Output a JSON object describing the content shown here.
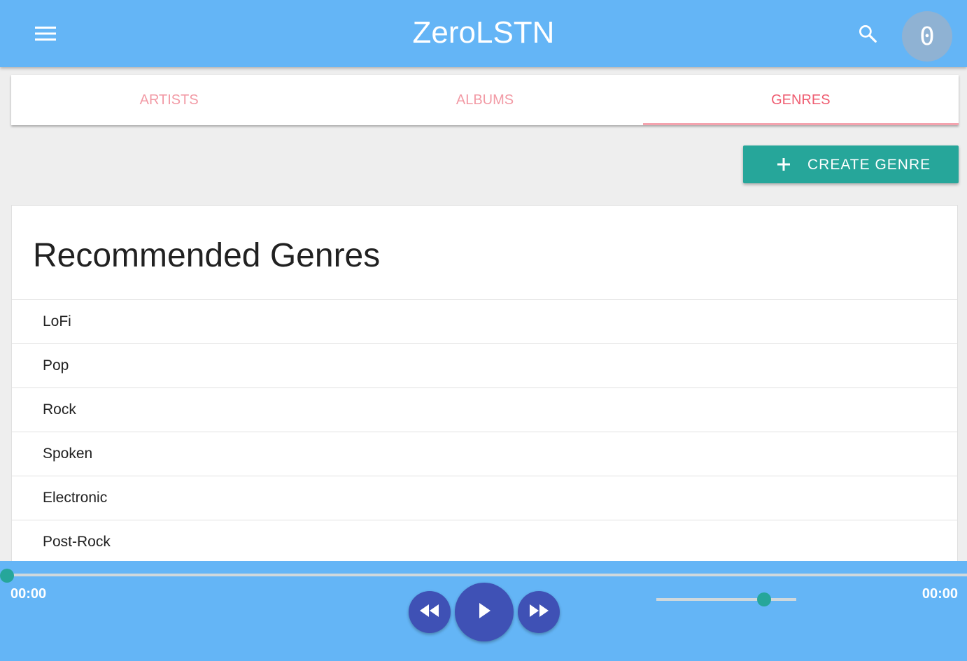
{
  "app": {
    "title": "ZeroLSTN",
    "avatar_text": "0"
  },
  "icons": {
    "menu": "menu-icon",
    "search": "search-icon",
    "add": "plus-icon",
    "rewind": "fast-rewind-icon",
    "play": "play-icon",
    "forward": "fast-forward-icon"
  },
  "tabs": [
    {
      "label": "ARTISTS",
      "active": false
    },
    {
      "label": "ALBUMS",
      "active": false
    },
    {
      "label": "GENRES",
      "active": true
    }
  ],
  "actions": {
    "create_label": "CREATE GENRE"
  },
  "card": {
    "title": "Recommended Genres",
    "items": [
      "LoFi",
      "Pop",
      "Rock",
      "Spoken",
      "Electronic",
      "Post-Rock"
    ]
  },
  "player": {
    "elapsed": "00:00",
    "duration": "00:00",
    "progress": 0,
    "volume": 0.77
  },
  "colors": {
    "appbar": "#64b5f6",
    "accent": "#26a69a",
    "tab_text": "#ef5d71",
    "control": "#3f51b5"
  }
}
